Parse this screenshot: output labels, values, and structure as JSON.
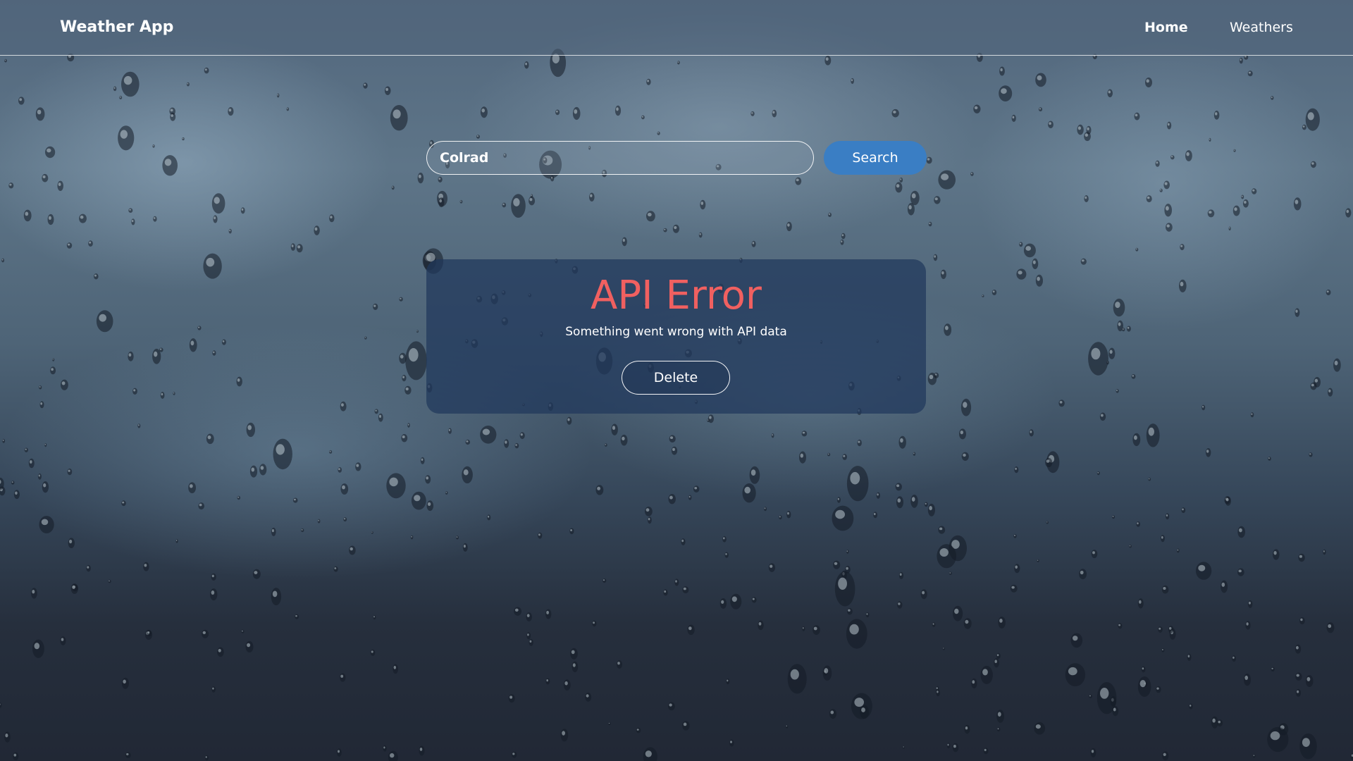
{
  "app": {
    "title": "Weather App"
  },
  "nav": {
    "items": [
      {
        "label": "Home",
        "active": true
      },
      {
        "label": "Weathers",
        "active": false
      }
    ]
  },
  "search": {
    "value": "Colrad",
    "button_label": "Search"
  },
  "error": {
    "title": "API Error",
    "message": "Something went wrong with API data",
    "button_label": "Delete"
  },
  "colors": {
    "accent": "#3a7ec4",
    "error": "#f06060",
    "card": "#20375c"
  },
  "background": {
    "description_icon": "rain-drops-background"
  }
}
